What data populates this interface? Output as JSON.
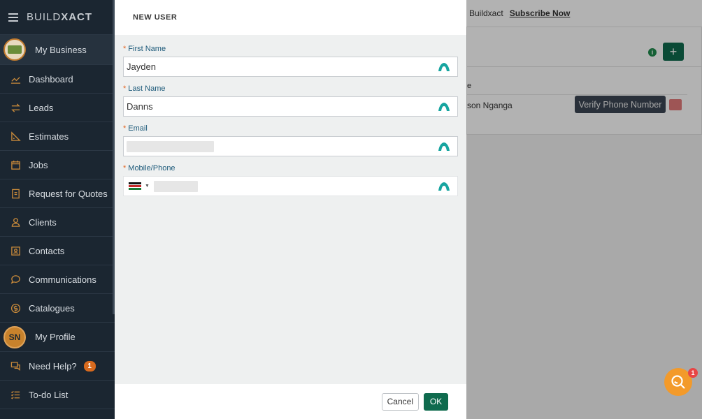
{
  "app": {
    "logo_light": "BUILD",
    "logo_bold": "XACT"
  },
  "sidebar": {
    "business": {
      "label": "My Business"
    },
    "items": [
      {
        "label": "Dashboard",
        "icon": "chart-line-icon"
      },
      {
        "label": "Leads",
        "icon": "arrows-icon"
      },
      {
        "label": "Estimates",
        "icon": "ruler-triangle-icon"
      },
      {
        "label": "Jobs",
        "icon": "calendar-icon"
      },
      {
        "label": "Request for Quotes",
        "icon": "quote-doc-icon"
      },
      {
        "label": "Clients",
        "icon": "person-icon"
      },
      {
        "label": "Contacts",
        "icon": "contact-card-icon"
      },
      {
        "label": "Communications",
        "icon": "chat-bubble-icon"
      },
      {
        "label": "Catalogues",
        "icon": "dollar-circle-icon"
      }
    ],
    "profile": {
      "initials": "SN",
      "label": "My Profile"
    },
    "help": {
      "label": "Need Help?",
      "badge": "1"
    },
    "todo": {
      "label": "To-do List"
    }
  },
  "background": {
    "topbar_text": "Buildxact",
    "subscribe": "Subscribe Now",
    "info": "i",
    "add": "+",
    "column_fragment": "e",
    "name_fragment": "son Nganga",
    "verify_button": "Verify Phone Number"
  },
  "modal": {
    "title": "NEW USER",
    "required_marker": "*",
    "fields": {
      "first_name": {
        "label": "First Name",
        "value": "Jayden"
      },
      "last_name": {
        "label": "Last Name",
        "value": "Danns"
      },
      "email": {
        "label": "Email",
        "value": ""
      },
      "phone": {
        "label": "Mobile/Phone",
        "value": "",
        "caret": "▼"
      }
    },
    "cancel": "Cancel",
    "ok": "OK"
  },
  "help_widget": {
    "badge": "1"
  },
  "colors": {
    "sidebar": "#1b2631",
    "accent_green": "#0f6b4e",
    "help_orange": "#f39a2a",
    "label_blue": "#1d5a7a"
  }
}
